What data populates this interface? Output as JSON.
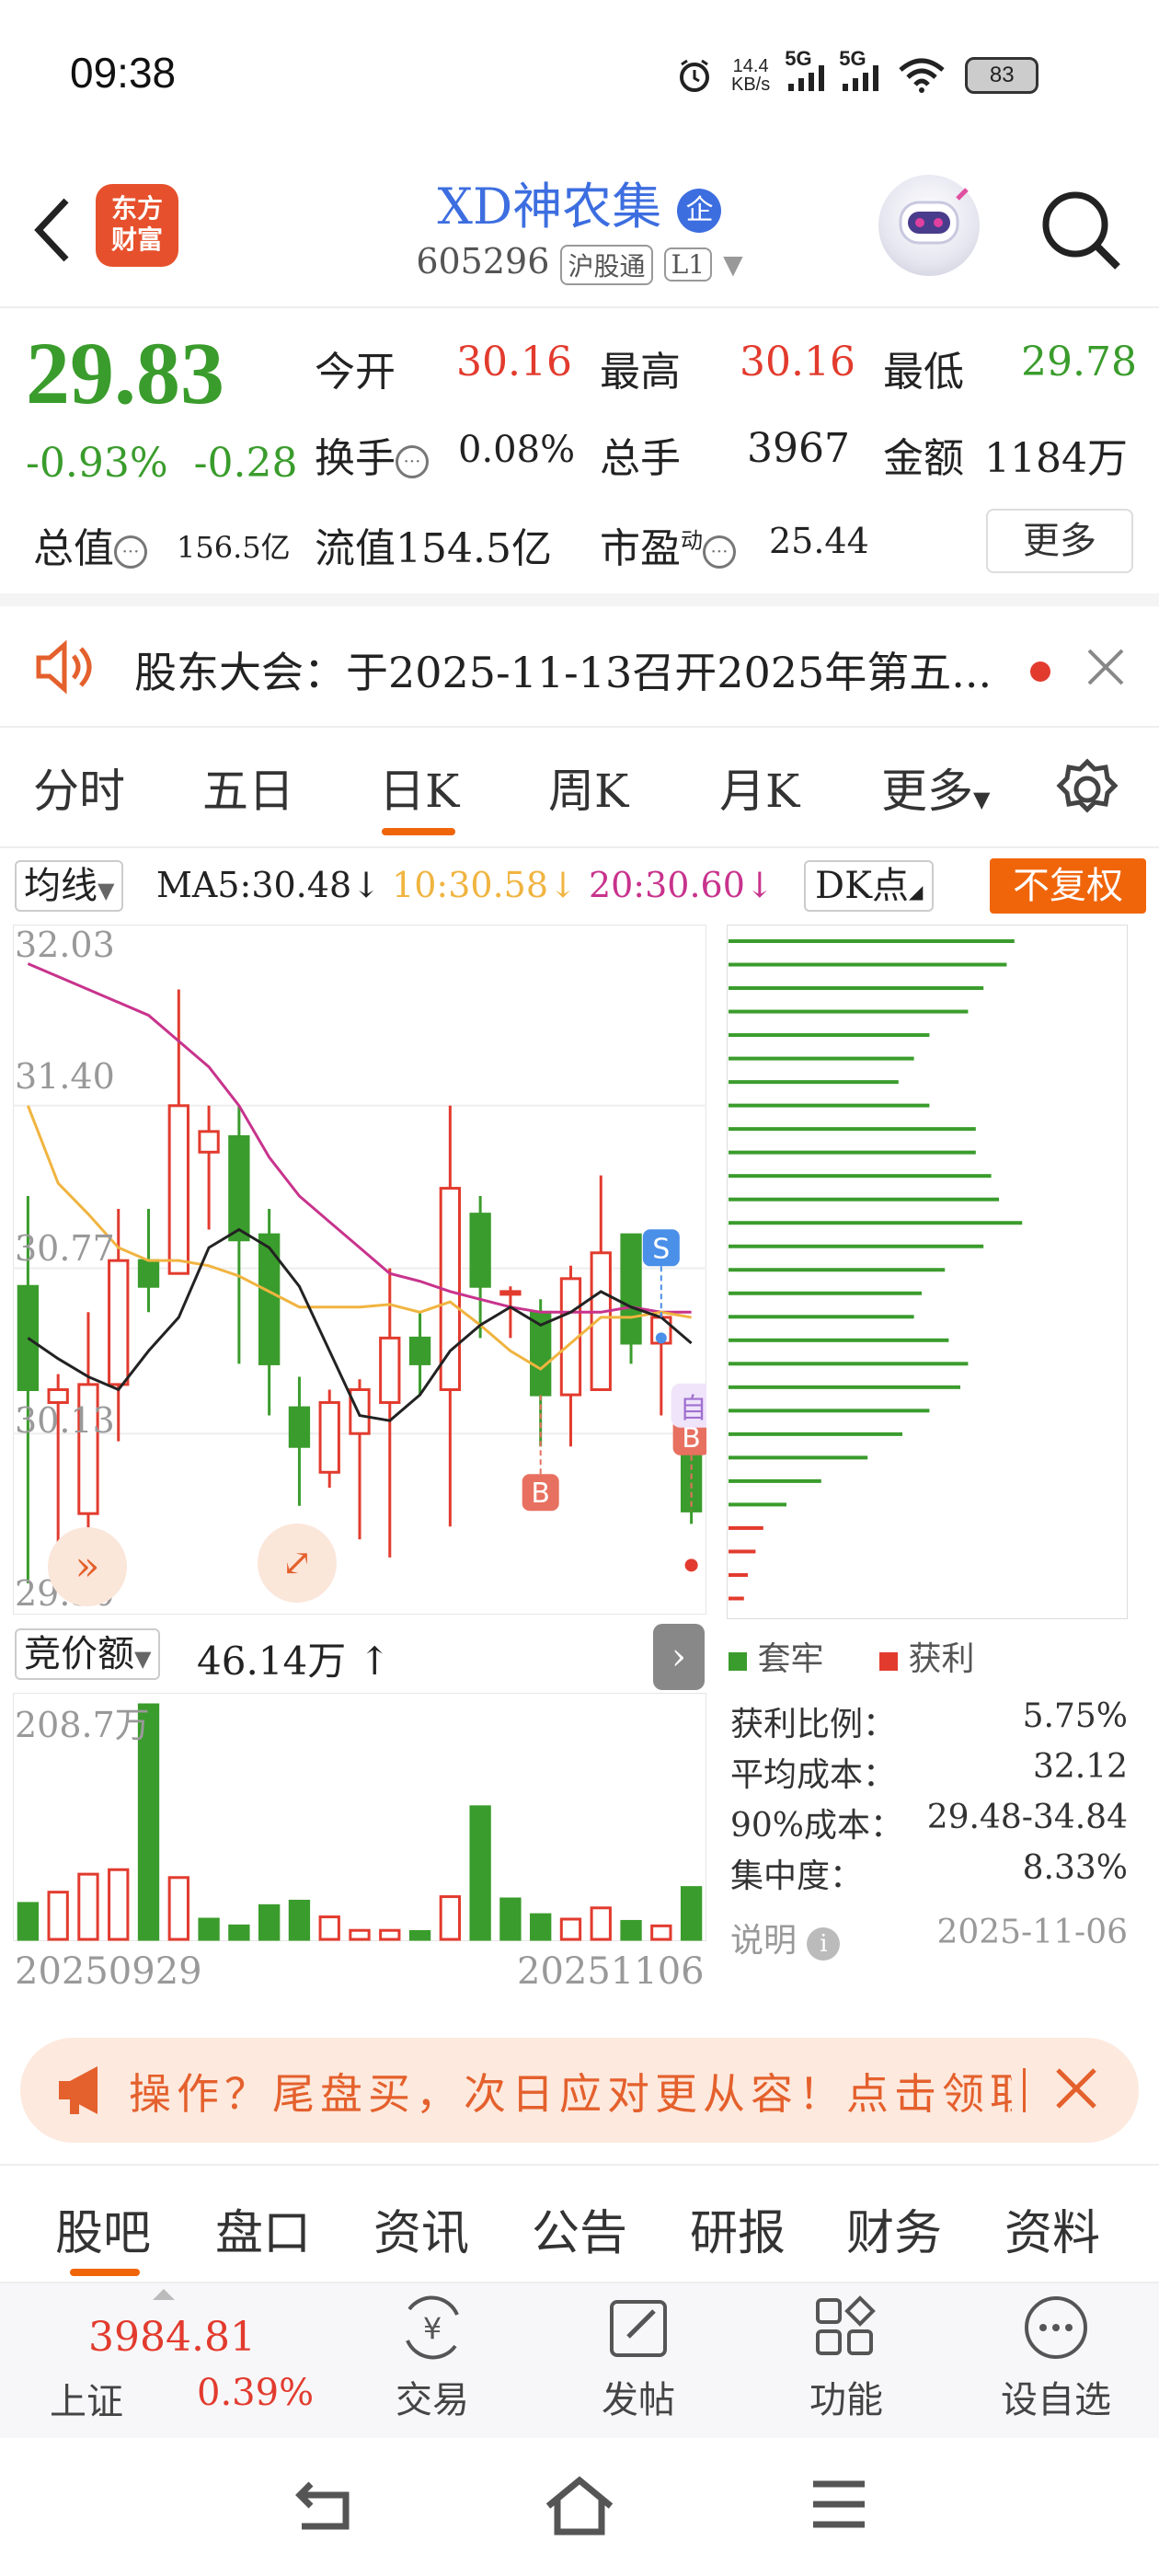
{
  "status_bar": {
    "time": "09:38",
    "net_speed_top": "14.4",
    "net_speed_bottom": "KB/s",
    "sig1": "5G",
    "sig2": "5G",
    "battery": "83"
  },
  "header": {
    "title": "XD神农集",
    "enterprise_badge": "企",
    "code": "605296",
    "market_tag": "沪股通",
    "level_tag": "L1",
    "brand": "东方\n财富"
  },
  "quote": {
    "price": "29.83",
    "change_pct": "-0.93%",
    "change_amt": "-0.28",
    "open_label": "今开",
    "open": "30.16",
    "high_label": "最高",
    "high": "30.16",
    "low_label": "最低",
    "low": "29.78",
    "turnover_label": "换手",
    "turnover": "0.08%",
    "volume_label": "总手",
    "volume": "3967",
    "amount_label": "金额",
    "amount": "1184万",
    "mktcap_label": "总值",
    "mktcap": "156.5亿",
    "float_label": "流值",
    "float": "154.5亿",
    "pe_label": "市盈",
    "pe_sup": "动",
    "pe": "25.44",
    "more": "更多"
  },
  "notice": {
    "text": "股东大会：于2025-11-13召开2025年第五..."
  },
  "chart_tabs": [
    "分时",
    "五日",
    "日K",
    "周K",
    "月K",
    "更多"
  ],
  "ma": {
    "selector": "均线",
    "ma5": "MA5:30.48",
    "ma10": "10:30.58",
    "ma20": "20:30.60",
    "dk": "DK点",
    "adjust": "不复权",
    "color_ma5": "#222222",
    "color_ma10": "#f0b440",
    "color_ma20": "#c8338c"
  },
  "chart_data": {
    "type": "candlestick",
    "y_ticks": [
      "32.03",
      "31.40",
      "30.77",
      "30.13",
      "29.50"
    ],
    "ylim": [
      29.5,
      32.03
    ],
    "x_start": "20250929",
    "x_end": "20251106",
    "candles": [
      {
        "o": 30.7,
        "c": 30.3,
        "h": 31.05,
        "l": 29.55
      },
      {
        "o": 30.25,
        "c": 30.3,
        "h": 30.36,
        "l": 29.6
      },
      {
        "o": 29.82,
        "c": 30.32,
        "h": 30.6,
        "l": 29.55
      },
      {
        "o": 30.32,
        "c": 30.8,
        "h": 31.0,
        "l": 30.1
      },
      {
        "o": 30.8,
        "c": 30.7,
        "h": 31.0,
        "l": 30.6
      },
      {
        "o": 30.75,
        "c": 31.4,
        "h": 31.85,
        "l": 30.75
      },
      {
        "o": 31.22,
        "c": 31.3,
        "h": 31.4,
        "l": 30.92
      },
      {
        "o": 31.28,
        "c": 30.88,
        "h": 31.4,
        "l": 30.4
      },
      {
        "o": 30.9,
        "c": 30.4,
        "h": 31.0,
        "l": 30.2
      },
      {
        "o": 30.23,
        "c": 30.08,
        "h": 30.35,
        "l": 29.85
      },
      {
        "o": 29.98,
        "c": 30.25,
        "h": 30.3,
        "l": 29.92
      },
      {
        "o": 30.13,
        "c": 30.3,
        "h": 30.34,
        "l": 29.72
      },
      {
        "o": 30.25,
        "c": 30.5,
        "h": 30.77,
        "l": 29.65
      },
      {
        "o": 30.5,
        "c": 30.4,
        "h": 30.6,
        "l": 30.28
      },
      {
        "o": 30.3,
        "c": 31.08,
        "h": 31.4,
        "l": 29.77
      },
      {
        "o": 30.98,
        "c": 30.7,
        "h": 31.05,
        "l": 30.5
      },
      {
        "o": 30.68,
        "c": 30.68,
        "h": 30.7,
        "l": 30.5
      },
      {
        "o": 30.6,
        "c": 30.28,
        "h": 30.65,
        "l": 30.08
      },
      {
        "o": 30.28,
        "c": 30.73,
        "h": 30.78,
        "l": 30.08
      },
      {
        "o": 30.3,
        "c": 30.83,
        "h": 31.13,
        "l": 30.3
      },
      {
        "o": 30.9,
        "c": 30.48,
        "h": 30.9,
        "l": 30.4
      },
      {
        "o": 30.48,
        "c": 30.58,
        "h": 30.6,
        "l": 30.2
      },
      {
        "o": 30.16,
        "c": 29.83,
        "h": 30.16,
        "l": 29.78
      }
    ],
    "ma5": [
      30.5,
      30.42,
      30.35,
      30.3,
      30.45,
      30.58,
      30.85,
      30.92,
      30.85,
      30.7,
      30.45,
      30.2,
      30.18,
      30.28,
      30.45,
      30.55,
      30.62,
      30.55,
      30.6,
      30.68,
      30.62,
      30.58,
      30.48
    ],
    "ma10": [
      31.4,
      31.1,
      30.98,
      30.85,
      30.8,
      30.8,
      30.78,
      30.74,
      30.68,
      30.62,
      30.62,
      30.62,
      30.63,
      30.6,
      30.64,
      30.55,
      30.45,
      30.38,
      30.48,
      30.58,
      30.58,
      30.6,
      30.58
    ],
    "ma20": [
      31.95,
      31.9,
      31.85,
      31.8,
      31.75,
      31.65,
      31.55,
      31.4,
      31.2,
      31.05,
      30.95,
      30.85,
      30.75,
      30.72,
      30.68,
      30.65,
      30.62,
      30.6,
      30.6,
      30.6,
      30.62,
      30.6,
      30.6
    ],
    "markers": [
      {
        "label": "S",
        "index": 21,
        "color": "#4a8fe8"
      },
      {
        "label": "B",
        "index": 17,
        "color": "#e87060"
      },
      {
        "label": "B",
        "index": 22,
        "color": "#e87060"
      },
      {
        "label": "自",
        "index": 22,
        "color": "#a070d0"
      }
    ],
    "volume_label": "竞价额",
    "volume_value": "46.14万",
    "volume_max_label": "208.7万",
    "volume_max": 208.7,
    "volume": [
      {
        "v": 32,
        "up": false
      },
      {
        "v": 42,
        "up": true
      },
      {
        "v": 58,
        "up": true
      },
      {
        "v": 62,
        "up": true
      },
      {
        "v": 208.7,
        "up": false
      },
      {
        "v": 55,
        "up": true
      },
      {
        "v": 18,
        "up": false
      },
      {
        "v": 12,
        "up": false
      },
      {
        "v": 30,
        "up": false
      },
      {
        "v": 34,
        "up": false
      },
      {
        "v": 20,
        "up": true
      },
      {
        "v": 8,
        "up": true
      },
      {
        "v": 8,
        "up": true
      },
      {
        "v": 7,
        "up": false
      },
      {
        "v": 38,
        "up": true
      },
      {
        "v": 118,
        "up": false
      },
      {
        "v": 36,
        "up": false
      },
      {
        "v": 22,
        "up": false
      },
      {
        "v": 18,
        "up": true
      },
      {
        "v": 28,
        "up": true
      },
      {
        "v": 16,
        "up": false
      },
      {
        "v": 12,
        "up": true
      },
      {
        "v": 46.14,
        "up": false
      }
    ],
    "chips": [
      {
        "w": 0.74,
        "profit": false
      },
      {
        "w": 0.72,
        "profit": false
      },
      {
        "w": 0.66,
        "profit": false
      },
      {
        "w": 0.62,
        "profit": false
      },
      {
        "w": 0.52,
        "profit": false
      },
      {
        "w": 0.48,
        "profit": false
      },
      {
        "w": 0.44,
        "profit": false
      },
      {
        "w": 0.52,
        "profit": false
      },
      {
        "w": 0.64,
        "profit": false
      },
      {
        "w": 0.64,
        "profit": false
      },
      {
        "w": 0.68,
        "profit": false
      },
      {
        "w": 0.7,
        "profit": false
      },
      {
        "w": 0.76,
        "profit": false
      },
      {
        "w": 0.66,
        "profit": false
      },
      {
        "w": 0.56,
        "profit": false
      },
      {
        "w": 0.5,
        "profit": false
      },
      {
        "w": 0.48,
        "profit": false
      },
      {
        "w": 0.57,
        "profit": false
      },
      {
        "w": 0.62,
        "profit": false
      },
      {
        "w": 0.6,
        "profit": false
      },
      {
        "w": 0.52,
        "profit": false
      },
      {
        "w": 0.45,
        "profit": false
      },
      {
        "w": 0.36,
        "profit": false
      },
      {
        "w": 0.24,
        "profit": false
      },
      {
        "w": 0.15,
        "profit": false
      },
      {
        "w": 0.09,
        "profit": true
      },
      {
        "w": 0.07,
        "profit": true
      },
      {
        "w": 0.05,
        "profit": true
      },
      {
        "w": 0.04,
        "profit": true
      }
    ],
    "color_up": "#e23b2e",
    "color_down": "#3a9c2c"
  },
  "chip_stats": {
    "legend_trapped": "套牢",
    "legend_profit": "获利",
    "rows": [
      {
        "label": "获利比例：",
        "value": "5.75%"
      },
      {
        "label": "平均成本：",
        "value": "32.12"
      },
      {
        "label": "90%成本：",
        "value": "29.48-34.84"
      },
      {
        "label": "集中度：",
        "value": "8.33%"
      }
    ],
    "note_label": "说明",
    "date": "2025-11-06"
  },
  "ad": {
    "text": "操作？尾盘买，次日应对更从容！点击领取【"
  },
  "bottom_tabs": [
    "股吧",
    "盘口",
    "资讯",
    "公告",
    "研报",
    "财务",
    "资料"
  ],
  "bottom_bar": {
    "index_value": "3984.81",
    "index_name": "上证",
    "index_pct": "0.39%",
    "trade": "交易",
    "post": "发帖",
    "function": "功能",
    "watchlist": "设自选"
  }
}
